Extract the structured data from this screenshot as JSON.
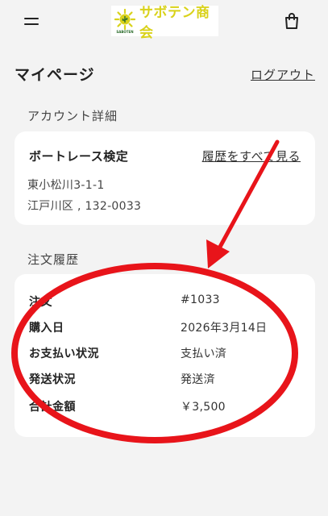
{
  "header": {
    "logo_text": "サボテン商会",
    "logo_badge_text": "SABOTEN",
    "menu_icon": "hamburger-menu-icon",
    "cart_icon": "shopping-bag-icon"
  },
  "page": {
    "title": "マイページ",
    "logout_label": "ログアウト"
  },
  "account": {
    "section_title": "アカウント詳細",
    "name": "ボートレース検定",
    "view_history_label": "履歴をすべて見る",
    "address_line1": "東小松川3-1-1",
    "address_line2": "江戸川区 , 132-0033"
  },
  "orders": {
    "section_title": "注文履歴",
    "rows": [
      {
        "label": "注文",
        "value": "#1033"
      },
      {
        "label": "購入日",
        "value": "2026年3月14日"
      },
      {
        "label": "お支払い状況",
        "value": "支払い済"
      },
      {
        "label": "発送状況",
        "value": "発送済"
      },
      {
        "label": "合計金額",
        "value": "￥3,500"
      }
    ]
  },
  "colors": {
    "background": "#f3f3f3",
    "card": "#ffffff",
    "logo_yellow": "#d9d21a",
    "annotation_red": "#e8141a"
  }
}
